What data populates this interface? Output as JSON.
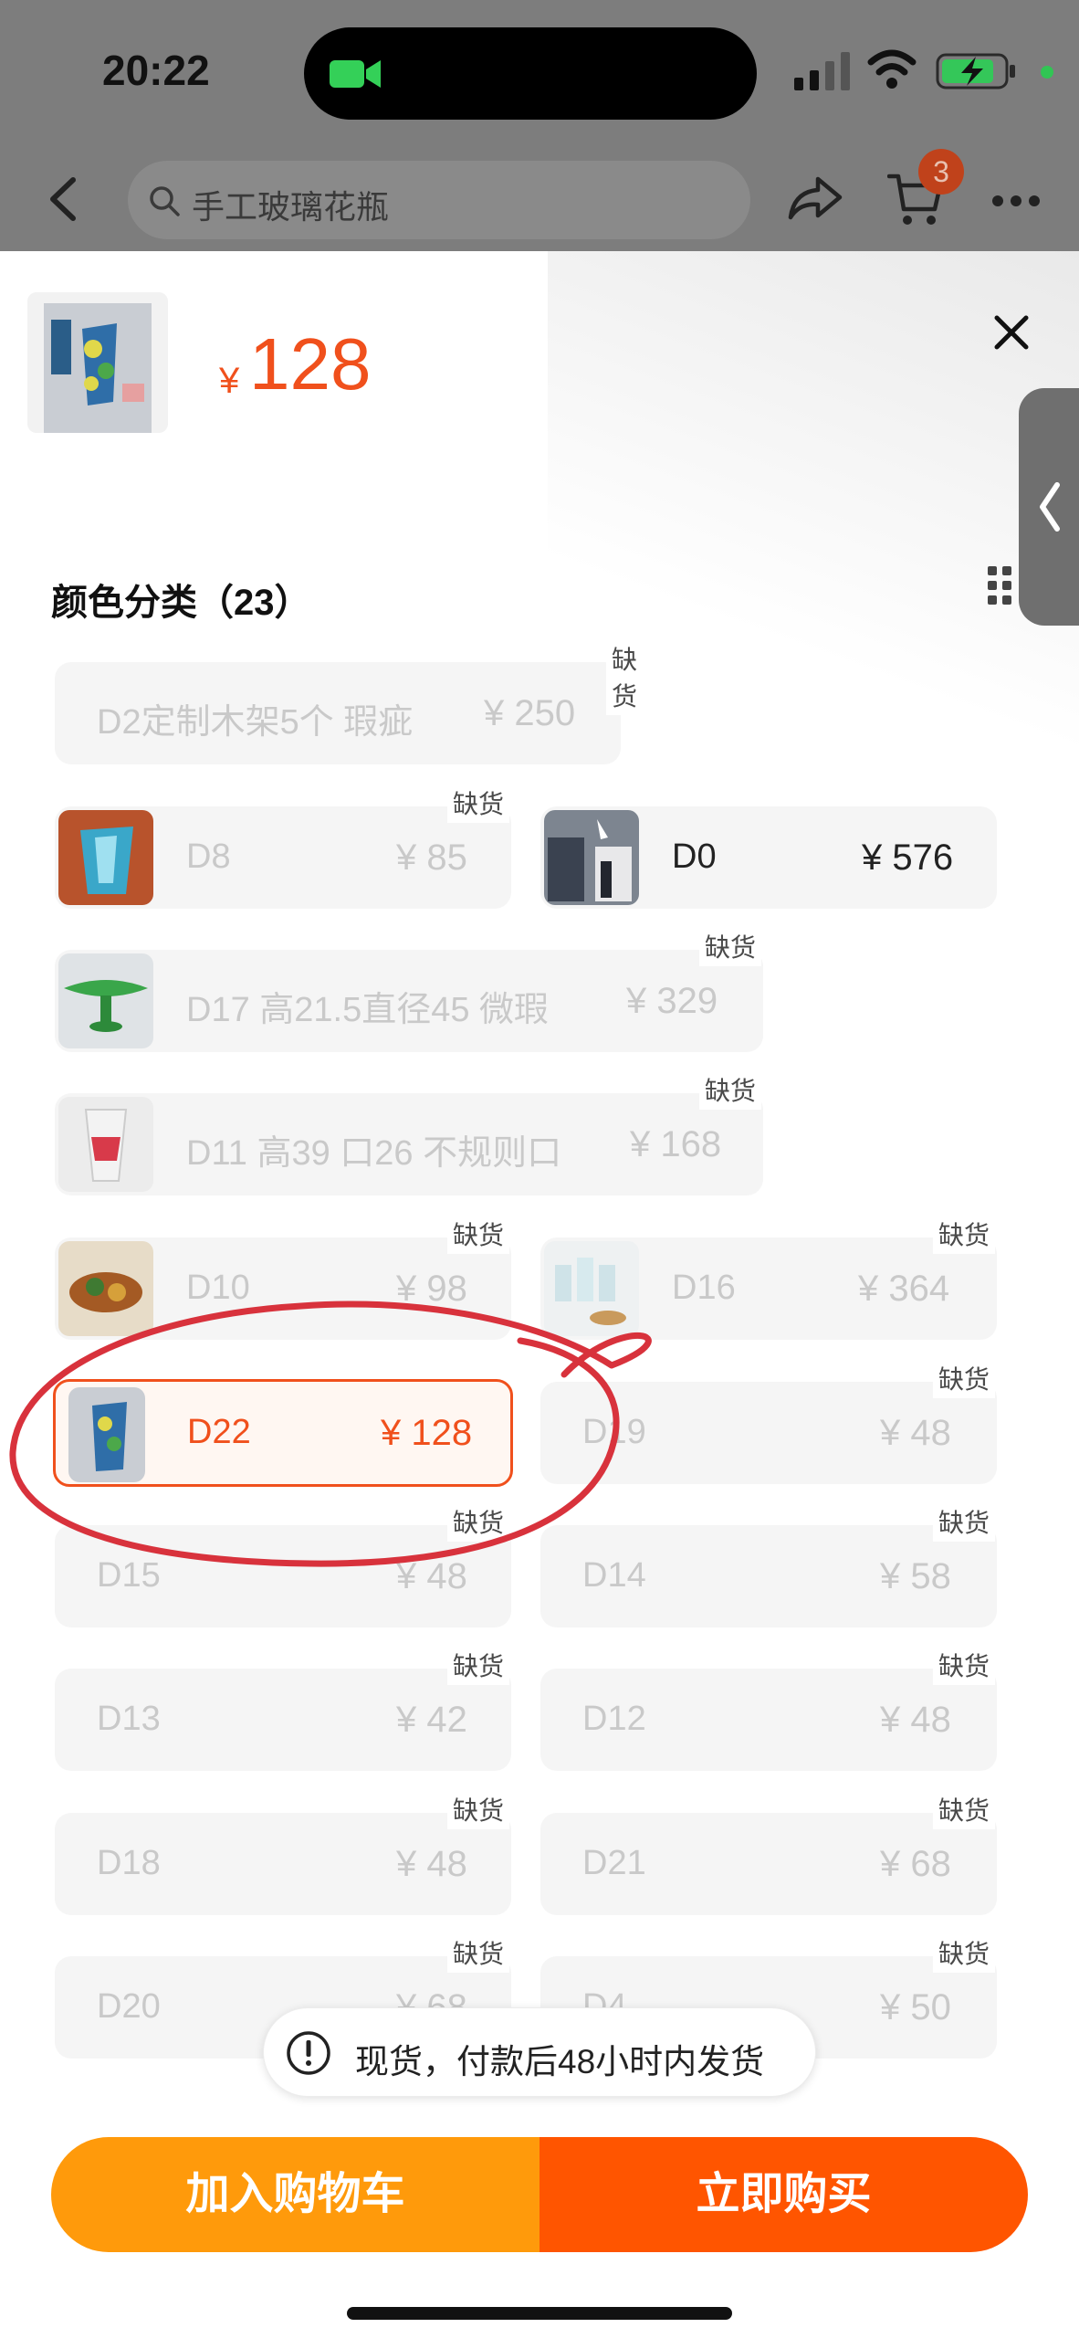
{
  "status_bar": {
    "time": "20:22"
  },
  "header": {
    "search_text": "手工玻璃花瓶",
    "cart_count": "3"
  },
  "product": {
    "currency": "¥",
    "price": "128"
  },
  "section": {
    "title": "颜色分类（23）"
  },
  "options": [
    {
      "label": "D2定制木架5个 瑕疵",
      "price": "¥ 250",
      "badge": "缺货"
    },
    {
      "label": "D8",
      "price": "¥ 85",
      "badge": "缺货"
    },
    {
      "label": "D0",
      "price": "¥ 576",
      "badge": ""
    },
    {
      "label": "D17 高21.5直径45  微瑕",
      "price": "¥ 329",
      "badge": "缺货"
    },
    {
      "label": "D11 高39 口26 不规则口",
      "price": "¥ 168",
      "badge": "缺货"
    },
    {
      "label": "D10",
      "price": "¥ 98",
      "badge": "缺货"
    },
    {
      "label": "D16",
      "price": "¥ 364",
      "badge": "缺货"
    },
    {
      "label": "D22",
      "price": "¥ 128",
      "badge": ""
    },
    {
      "label": "D19",
      "price": "¥ 48",
      "badge": "缺货"
    },
    {
      "label": "D15",
      "price": "¥ 48",
      "badge": "缺货"
    },
    {
      "label": "D14",
      "price": "¥ 58",
      "badge": "缺货"
    },
    {
      "label": "D13",
      "price": "¥ 42",
      "badge": "缺货"
    },
    {
      "label": "D12",
      "price": "¥ 48",
      "badge": "缺货"
    },
    {
      "label": "D18",
      "price": "¥ 48",
      "badge": "缺货"
    },
    {
      "label": "D21",
      "price": "¥ 68",
      "badge": "缺货"
    },
    {
      "label": "D20",
      "price": "¥ 68",
      "badge": "缺货"
    },
    {
      "label": "D4",
      "price": "¥ 50",
      "badge": "缺货"
    }
  ],
  "notice": {
    "text": "现货，付款后48小时内发货"
  },
  "actions": {
    "add_to_cart": "加入购物车",
    "buy_now": "立即购买"
  },
  "colors": {
    "accent": "#f0501c",
    "cart_button": "#ff9a0b",
    "buy_button": "#ff5500",
    "annotation": "#d8323c"
  }
}
